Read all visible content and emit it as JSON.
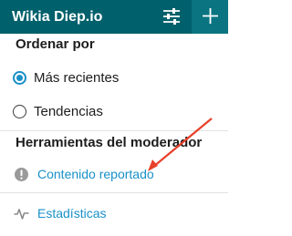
{
  "header": {
    "title": "Wikia Diep.io",
    "filter_icon": "sliders-icon",
    "add_icon": "plus-icon",
    "colors": {
      "bar": "#00606b",
      "add_button": "#0a7581"
    }
  },
  "sort": {
    "heading": "Ordenar por",
    "options": [
      {
        "label": "Más recientes",
        "selected": true
      },
      {
        "label": "Tendencias",
        "selected": false
      }
    ]
  },
  "moderator_tools": {
    "heading": "Herramientas del moderador",
    "items": [
      {
        "label": "Contenido reportado",
        "icon": "alert-circle-icon"
      },
      {
        "label": "Estadísticas",
        "icon": "pulse-icon"
      }
    ]
  },
  "annotation": {
    "arrow_color": "#e8402a"
  },
  "colors": {
    "link": "#1a90c8",
    "text": "#1d1d1d"
  }
}
